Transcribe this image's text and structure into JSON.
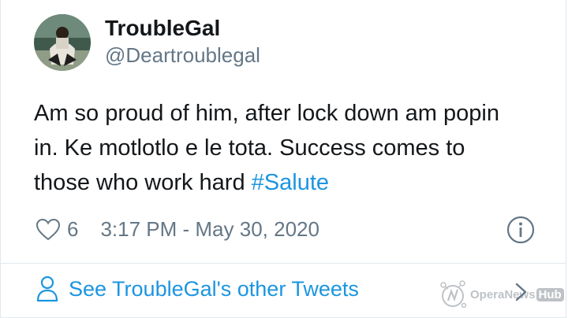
{
  "user": {
    "display_name": "TroubleGal",
    "handle": "@Deartroublegal"
  },
  "tweet": {
    "text": "Am so proud of him, after lock down am popin in. Ke motlotlo e le tota. Success comes to those who work hard ",
    "hashtag": "#Salute",
    "like_count": "6",
    "timestamp": "3:17 PM - May 30, 2020"
  },
  "footer": {
    "link_label": "See TroubleGal's other Tweets"
  },
  "watermark": {
    "brand": "OperaNews",
    "hub": "Hub"
  },
  "colors": {
    "accent": "#1b95e0",
    "secondary_text": "#657786",
    "primary_text": "#14171a"
  },
  "icons": {
    "like": "heart-icon",
    "info": "info-icon",
    "profile": "user-icon",
    "more": "chevron-right-icon"
  }
}
